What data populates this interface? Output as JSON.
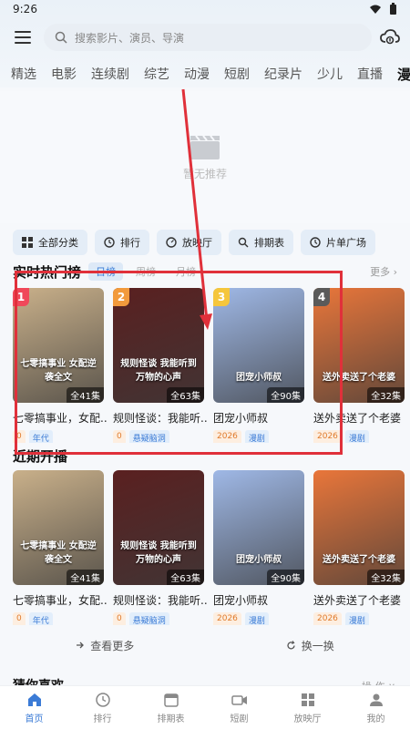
{
  "status": {
    "time": "9:26"
  },
  "search": {
    "placeholder": "搜索影片、演员、导演"
  },
  "tabs": [
    "精选",
    "电影",
    "连续剧",
    "综艺",
    "动漫",
    "短剧",
    "纪录片",
    "少儿",
    "直播",
    "漫剧"
  ],
  "active_tab": "漫剧",
  "banner": {
    "text": "暂无推荐"
  },
  "quick_actions": [
    "全部分类",
    "排行",
    "放映厅",
    "排期表",
    "片单广场"
  ],
  "hot": {
    "title": "实时热门榜",
    "tabs": [
      "日榜",
      "周榜",
      "月榜"
    ],
    "more": "更多 ›"
  },
  "items": [
    {
      "title": "七零搞事业，女配...",
      "eps": "全41集",
      "year": "0",
      "tag": "年代",
      "rank": "1",
      "badge_color": "#f0485a",
      "poster_text": "七零搞事业 女配逆袭全文",
      "poster_color": "#c9b08a"
    },
    {
      "title": "规则怪谈：我能听...",
      "eps": "全63集",
      "year": "0",
      "tag": "悬疑脑洞",
      "rank": "2",
      "badge_color": "#f29a3c",
      "poster_text": "规则怪谈 我能听到万物的心声",
      "poster_color": "#5a2020"
    },
    {
      "title": "团宠小师叔",
      "eps": "全90集",
      "year": "2026",
      "tag": "漫剧",
      "rank": "3",
      "badge_color": "#f5c63c",
      "poster_text": "团宠小师叔",
      "poster_color": "#9fb8e6"
    },
    {
      "title": "送外卖送了个老婆",
      "eps": "全32集",
      "year": "2026",
      "tag": "漫剧",
      "rank": "4",
      "badge_color": "#5a5a5a",
      "poster_text": "送外卖送了个老婆",
      "poster_color": "#e9763a"
    }
  ],
  "upcoming": {
    "title": "近期开播"
  },
  "actions": {
    "more": "查看更多",
    "refresh": "换一换"
  },
  "guess": {
    "title": "猜你喜欢",
    "right": "操  作 ∨"
  },
  "bottom_nav": [
    "首页",
    "排行",
    "排期表",
    "短剧",
    "放映厅",
    "我的"
  ]
}
